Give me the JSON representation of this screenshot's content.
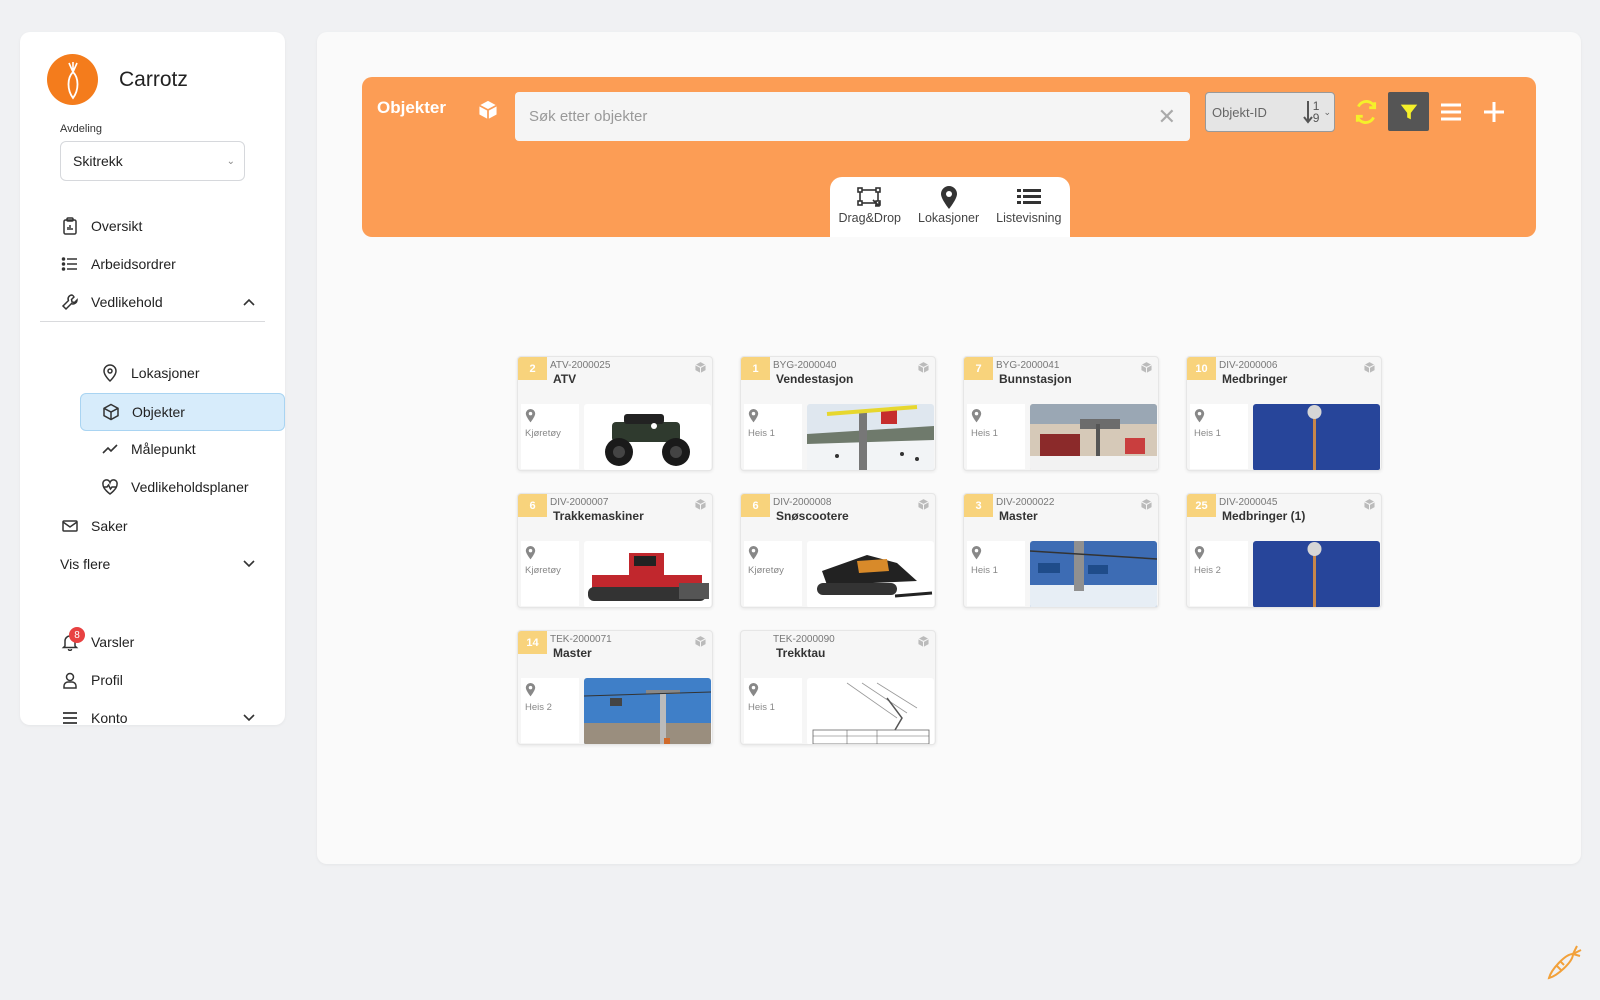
{
  "brand": {
    "name": "Carrotz"
  },
  "department": {
    "label": "Avdeling",
    "value": "Skitrekk"
  },
  "nav": {
    "oversikt": "Oversikt",
    "arbeidsordrer": "Arbeidsordrer",
    "vedlikehold": "Vedlikehold",
    "lokasjoner": "Lokasjoner",
    "objekter": "Objekter",
    "malepunkt": "Målepunkt",
    "vedlikeholdsplaner": "Vedlikeholdsplaner",
    "saker": "Saker",
    "vis_flere": "Vis flere",
    "varsler": "Varsler",
    "varsler_count": "8",
    "profil": "Profil",
    "konto": "Konto"
  },
  "topbar": {
    "title": "Objekter",
    "search_placeholder": "Søk etter objekter",
    "sort_field": "Objekt-ID",
    "sort_dir_top": "1",
    "sort_dir_bottom": "9",
    "accent": "#fc9d55"
  },
  "views": [
    {
      "label": "Drag&Drop",
      "icon": "drag-drop-icon"
    },
    {
      "label": "Lokasjoner",
      "icon": "map-pin-icon"
    },
    {
      "label": "Listevisning",
      "icon": "list-icon"
    }
  ],
  "objects": [
    {
      "count": "2",
      "id": "ATV-2000025",
      "name": "ATV",
      "location": "Kjøretøy",
      "image": "atv"
    },
    {
      "count": "1",
      "id": "BYG-2000040",
      "name": "Vendestasjon",
      "location": "Heis 1",
      "image": "ski-lift-slope"
    },
    {
      "count": "7",
      "id": "BYG-2000041",
      "name": "Bunnstasjon",
      "location": "Heis 1",
      "image": "lift-station"
    },
    {
      "count": "10",
      "id": "DIV-2000006",
      "name": "Medbringer",
      "location": "Heis 1",
      "image": "pole-blue"
    },
    {
      "count": "6",
      "id": "DIV-2000007",
      "name": "Trakkemaskiner",
      "location": "Kjøretøy",
      "image": "snow-groomer"
    },
    {
      "count": "6",
      "id": "DIV-2000008",
      "name": "Snøscootere",
      "location": "Kjøretøy",
      "image": "snowmobile"
    },
    {
      "count": "3",
      "id": "DIV-2000022",
      "name": "Master",
      "location": "Heis 1",
      "image": "chairlift"
    },
    {
      "count": "25",
      "id": "DIV-2000045",
      "name": "Medbringer (1)",
      "location": "Heis 2",
      "image": "pole-blue"
    },
    {
      "count": "14",
      "id": "TEK-2000071",
      "name": "Master",
      "location": "Heis 2",
      "image": "lift-tower"
    },
    {
      "count": "",
      "id": "TEK-2000090",
      "name": "Trekktau",
      "location": "Heis 1",
      "image": "technical-drawing"
    }
  ]
}
